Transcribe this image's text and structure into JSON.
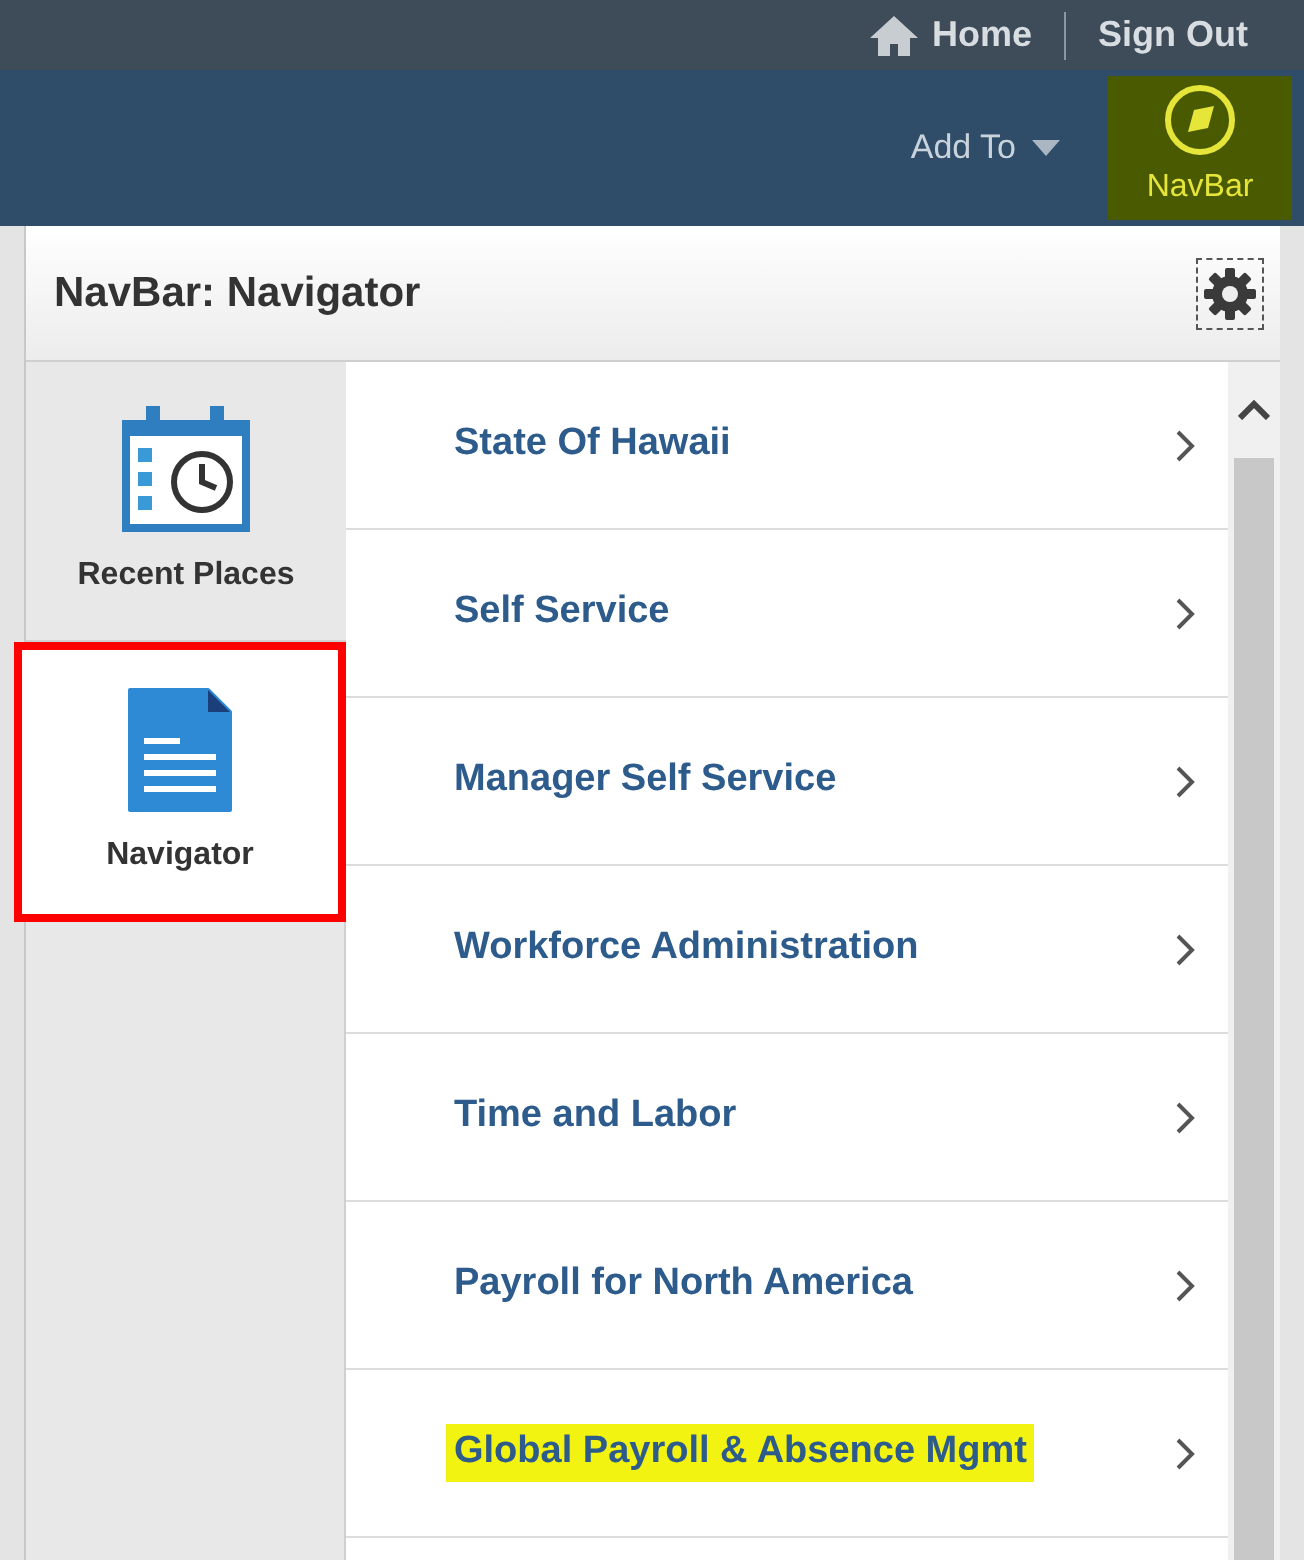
{
  "top_bar": {
    "links": [
      {
        "label": "Home"
      },
      {
        "label": "Sign Out"
      }
    ]
  },
  "header": {
    "add_to": {
      "label": "Add To"
    },
    "navbar_button": {
      "label": "NavBar",
      "highlighted": true
    }
  },
  "panel": {
    "title": "NavBar: Navigator",
    "tiles": [
      {
        "label": "Recent Places",
        "kind": "recent",
        "selected": false
      },
      {
        "label": "Navigator",
        "kind": "navigator",
        "selected": true
      }
    ],
    "items": [
      {
        "label": "State Of Hawaii",
        "highlighted": false
      },
      {
        "label": "Self Service",
        "highlighted": false
      },
      {
        "label": "Manager Self Service",
        "highlighted": false
      },
      {
        "label": "Workforce Administration",
        "highlighted": false
      },
      {
        "label": "Time and Labor",
        "highlighted": false
      },
      {
        "label": "Payroll for North America",
        "highlighted": false
      },
      {
        "label": "Global Payroll & Absence Mgmt",
        "highlighted": true
      }
    ]
  }
}
